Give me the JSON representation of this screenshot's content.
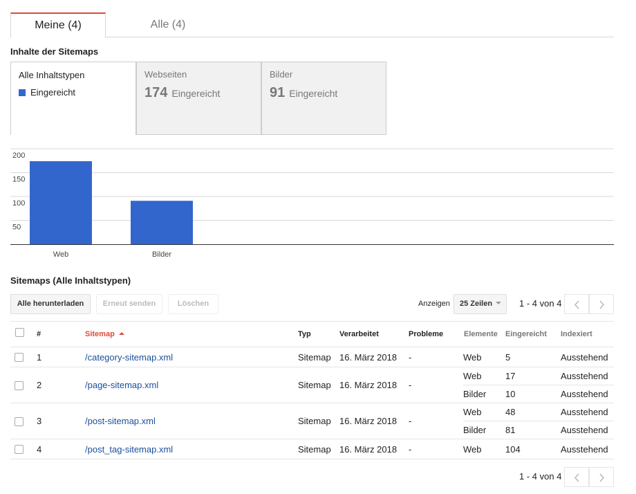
{
  "tabs": [
    {
      "label": "Meine (4)",
      "active": true
    },
    {
      "label": "Alle (4)",
      "active": false
    }
  ],
  "content_section_title": "Inhalte der Sitemaps",
  "legend_card": {
    "title": "Alle Inhaltstypen",
    "item": "Eingereicht",
    "color": "#3366cc"
  },
  "cards": [
    {
      "title": "Webseiten",
      "count": "174",
      "label": "Eingereicht"
    },
    {
      "title": "Bilder",
      "count": "91",
      "label": "Eingereicht"
    }
  ],
  "chart_data": {
    "type": "bar",
    "categories": [
      "Web",
      "Bilder"
    ],
    "series": [
      {
        "name": "Eingereicht",
        "values": [
          174,
          91
        ]
      }
    ],
    "ylim": [
      0,
      200
    ],
    "yticks": [
      50,
      100,
      150,
      200
    ],
    "grid": true,
    "color": "#3366cc"
  },
  "sitemaps_title": "Sitemaps (Alle Inhaltstypen)",
  "toolbar": {
    "download_label": "Alle herunterladen",
    "resend_label": "Erneut senden",
    "delete_label": "Löschen",
    "show_label": "Anzeigen",
    "rows_value": "25 Zeilen",
    "range_text": "1 - 4 von 4"
  },
  "table": {
    "headers": {
      "num": "#",
      "sitemap": "Sitemap",
      "type": "Typ",
      "processed": "Verarbeitet",
      "problems": "Probleme",
      "elements": "Elemente",
      "submitted": "Eingereicht",
      "indexed": "Indexiert"
    },
    "rows": [
      {
        "num": "1",
        "sitemap": "/category-sitemap.xml",
        "type": "Sitemap",
        "processed": "16. März 2018",
        "problems": "-",
        "items": [
          {
            "element": "Web",
            "submitted": "5",
            "indexed": "Ausstehend"
          }
        ]
      },
      {
        "num": "2",
        "sitemap": "/page-sitemap.xml",
        "type": "Sitemap",
        "processed": "16. März 2018",
        "problems": "-",
        "items": [
          {
            "element": "Web",
            "submitted": "17",
            "indexed": "Ausstehend"
          },
          {
            "element": "Bilder",
            "submitted": "10",
            "indexed": "Ausstehend"
          }
        ]
      },
      {
        "num": "3",
        "sitemap": "/post-sitemap.xml",
        "type": "Sitemap",
        "processed": "16. März 2018",
        "problems": "-",
        "items": [
          {
            "element": "Web",
            "submitted": "48",
            "indexed": "Ausstehend"
          },
          {
            "element": "Bilder",
            "submitted": "81",
            "indexed": "Ausstehend"
          }
        ]
      },
      {
        "num": "4",
        "sitemap": "/post_tag-sitemap.xml",
        "type": "Sitemap",
        "processed": "16. März 2018",
        "problems": "-",
        "items": [
          {
            "element": "Web",
            "submitted": "104",
            "indexed": "Ausstehend"
          }
        ]
      }
    ]
  },
  "footer": {
    "range_text": "1 - 4 von 4"
  },
  "icons": {
    "prev": "chevron-left-icon",
    "next": "chevron-right-icon",
    "sort": "sort-ascending-icon",
    "dropdown": "caret-down-icon"
  }
}
